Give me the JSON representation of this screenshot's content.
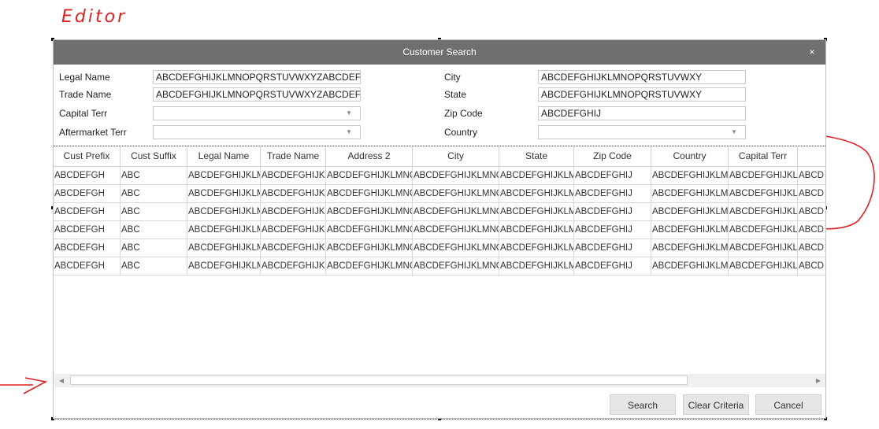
{
  "annotation": {
    "editor_text": "Editor"
  },
  "dialog": {
    "title": "Customer Search",
    "close_glyph": "×",
    "fields": {
      "legal_name": {
        "label": "Legal Name",
        "value": "ABCDEFGHIJKLMNOPQRSTUVWXYZABCDEFGHI"
      },
      "trade_name": {
        "label": "Trade Name",
        "value": "ABCDEFGHIJKLMNOPQRSTUVWXYZABCDEFGHI"
      },
      "capital_terr": {
        "label": "Capital Terr",
        "value": ""
      },
      "aftermarket_terr": {
        "label": "Aftermarket Terr",
        "value": ""
      },
      "city": {
        "label": "City",
        "value": "ABCDEFGHIJKLMNOPQRSTUVWXY"
      },
      "state": {
        "label": "State",
        "value": "ABCDEFGHIJKLMNOPQRSTUVWXY"
      },
      "zip_code": {
        "label": "Zip Code",
        "value": "ABCDEFGHIJ"
      },
      "country": {
        "label": "Country",
        "value": ""
      }
    },
    "grid": {
      "columns": [
        "Cust Prefix",
        "Cust Suffix",
        "Legal Name",
        "Trade Name",
        "Address 2",
        "City",
        "State",
        "Zip Code",
        "Country",
        "Capital Terr",
        ""
      ],
      "rows": [
        [
          "ABCDEFGH",
          "ABC",
          "ABCDEFGHIJKLM",
          "ABCDEFGHIJKLI",
          "ABCDEFGHIJKLMNO",
          "ABCDEFGHIJKLMNO",
          "ABCDEFGHIJKLM",
          "ABCDEFGHIJ",
          "ABCDEFGHIJKLMN",
          "ABCDEFGHIJKLN",
          "ABCD"
        ],
        [
          "ABCDEFGH",
          "ABC",
          "ABCDEFGHIJKLM",
          "ABCDEFGHIJKLI",
          "ABCDEFGHIJKLMNO",
          "ABCDEFGHIJKLMNO",
          "ABCDEFGHIJKLM",
          "ABCDEFGHIJ",
          "ABCDEFGHIJKLMN",
          "ABCDEFGHIJKLN",
          "ABCD"
        ],
        [
          "ABCDEFGH",
          "ABC",
          "ABCDEFGHIJKLM",
          "ABCDEFGHIJKLI",
          "ABCDEFGHIJKLMNO",
          "ABCDEFGHIJKLMNO",
          "ABCDEFGHIJKLM",
          "ABCDEFGHIJ",
          "ABCDEFGHIJKLMN",
          "ABCDEFGHIJKLN",
          "ABCD"
        ],
        [
          "ABCDEFGH",
          "ABC",
          "ABCDEFGHIJKLM",
          "ABCDEFGHIJKLI",
          "ABCDEFGHIJKLMNO",
          "ABCDEFGHIJKLMNO",
          "ABCDEFGHIJKLM",
          "ABCDEFGHIJ",
          "ABCDEFGHIJKLMN",
          "ABCDEFGHIJKLN",
          "ABCD"
        ],
        [
          "ABCDEFGH",
          "ABC",
          "ABCDEFGHIJKLM",
          "ABCDEFGHIJKLI",
          "ABCDEFGHIJKLMNO",
          "ABCDEFGHIJKLMNO",
          "ABCDEFGHIJKLM",
          "ABCDEFGHIJ",
          "ABCDEFGHIJKLMN",
          "ABCDEFGHIJKLN",
          "ABCD"
        ],
        [
          "ABCDEFGH",
          "ABC",
          "ABCDEFGHIJKLM",
          "ABCDEFGHIJKLI",
          "ABCDEFGHIJKLMNO",
          "ABCDEFGHIJKLMNO",
          "ABCDEFGHIJKLM",
          "ABCDEFGHIJ",
          "ABCDEFGHIJKLMN",
          "ABCDEFGHIJKLN",
          "ABCD"
        ]
      ]
    },
    "buttons": {
      "search": "Search",
      "clear": "Clear Criteria",
      "cancel": "Cancel"
    }
  },
  "colors": {
    "titlebar": "#6f6f6f",
    "annotation_ink": "#e02020"
  }
}
